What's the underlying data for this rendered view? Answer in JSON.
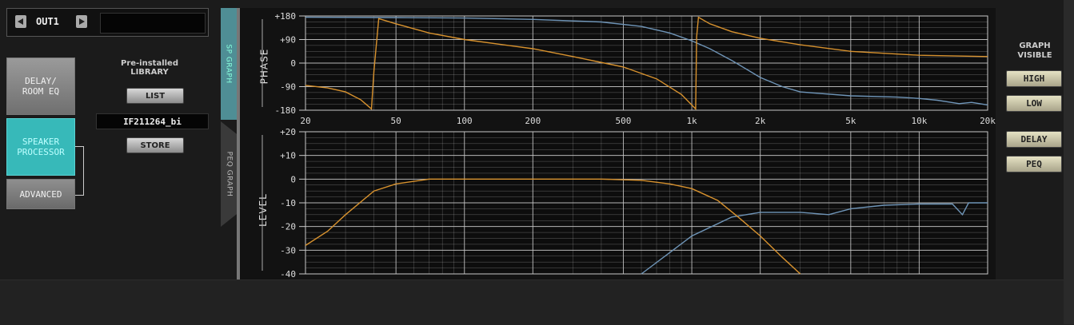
{
  "channel": {
    "label": "OUT1",
    "name": ""
  },
  "left_buttons": {
    "delay": "DELAY/\nROOM EQ",
    "speaker": "SPEAKER\nPROCESSOR",
    "advanced": "ADVANCED"
  },
  "library": {
    "title": "Pre-installed\nLIBRARY",
    "list_label": "LIST",
    "file": "IF211264_bi",
    "store_label": "STORE"
  },
  "tabs": {
    "sp_graph": "SP GRAPH",
    "peq_graph": "PEQ GRAPH"
  },
  "graph_visible": {
    "title": "GRAPH\nVISIBLE",
    "high": "HIGH",
    "low": "LOW",
    "delay": "DELAY",
    "peq": "PEQ"
  },
  "colors": {
    "high_curve": "#6f95b8",
    "low_curve": "#d8922e",
    "active_tab": "#37b9b9",
    "grid": "#c8c8c8"
  },
  "chart_data": [
    {
      "type": "line",
      "title": "",
      "ylabel": "PHASE",
      "xlabel": "",
      "x_scale": "log",
      "xlim": [
        20,
        20000
      ],
      "ylim": [
        -180,
        180
      ],
      "yticks": [
        "+180",
        "+90",
        "0",
        "-90",
        "-180"
      ],
      "xticks": [
        "20",
        "50",
        "100",
        "200",
        "500",
        "1k",
        "2k",
        "5k",
        "10k",
        "20k"
      ],
      "grid": true,
      "series": [
        {
          "color": "#6f95b8",
          "x": [
            20,
            50,
            100,
            200,
            400,
            600,
            800,
            1000,
            1200,
            1500,
            2000,
            2500,
            3000,
            5000,
            8000,
            10000,
            12000,
            15000,
            17000,
            20000
          ],
          "y": [
            175,
            174,
            172,
            167,
            157,
            140,
            115,
            85,
            55,
            10,
            -55,
            -90,
            -110,
            -125,
            -130,
            -135,
            -142,
            -155,
            -150,
            -160
          ]
        },
        {
          "color": "#d8922e",
          "x": [
            20,
            25,
            30,
            35,
            39,
            40,
            42,
            50,
            70,
            100,
            200,
            300,
            500,
            700,
            900,
            1040,
            1050,
            1070,
            1200,
            1500,
            2000,
            3000,
            5000,
            10000,
            20000
          ],
          "y": [
            -85,
            -95,
            -110,
            -140,
            -175,
            -30,
            170,
            150,
            115,
            90,
            55,
            25,
            -15,
            -60,
            -120,
            -175,
            100,
            175,
            150,
            120,
            95,
            70,
            45,
            30,
            25
          ]
        }
      ]
    },
    {
      "type": "line",
      "title": "",
      "ylabel": "LEVEL",
      "xlabel": "",
      "x_scale": "log",
      "xlim": [
        20,
        20000
      ],
      "ylim": [
        -40,
        20
      ],
      "yticks": [
        "+20",
        "+10",
        "0",
        "-10",
        "-20",
        "-30",
        "-40"
      ],
      "grid": true,
      "series": [
        {
          "color": "#6f95b8",
          "x": [
            600,
            800,
            1000,
            1500,
            2000,
            3000,
            4000,
            5000,
            7000,
            10000,
            14000,
            15500,
            16500,
            20000
          ],
          "y": [
            -40,
            -31,
            -24,
            -16,
            -14,
            -14,
            -15,
            -12.5,
            -11,
            -10.5,
            -10.5,
            -15,
            -10,
            -10
          ]
        },
        {
          "color": "#d8922e",
          "x": [
            20,
            25,
            30,
            40,
            50,
            70,
            100,
            200,
            400,
            600,
            800,
            1000,
            1300,
            1600,
            2000,
            2500,
            3000
          ],
          "y": [
            -28,
            -22,
            -15,
            -5,
            -2,
            0,
            0,
            0,
            0,
            -0.5,
            -2,
            -4,
            -9,
            -16,
            -24,
            -33,
            -40
          ]
        }
      ]
    }
  ]
}
